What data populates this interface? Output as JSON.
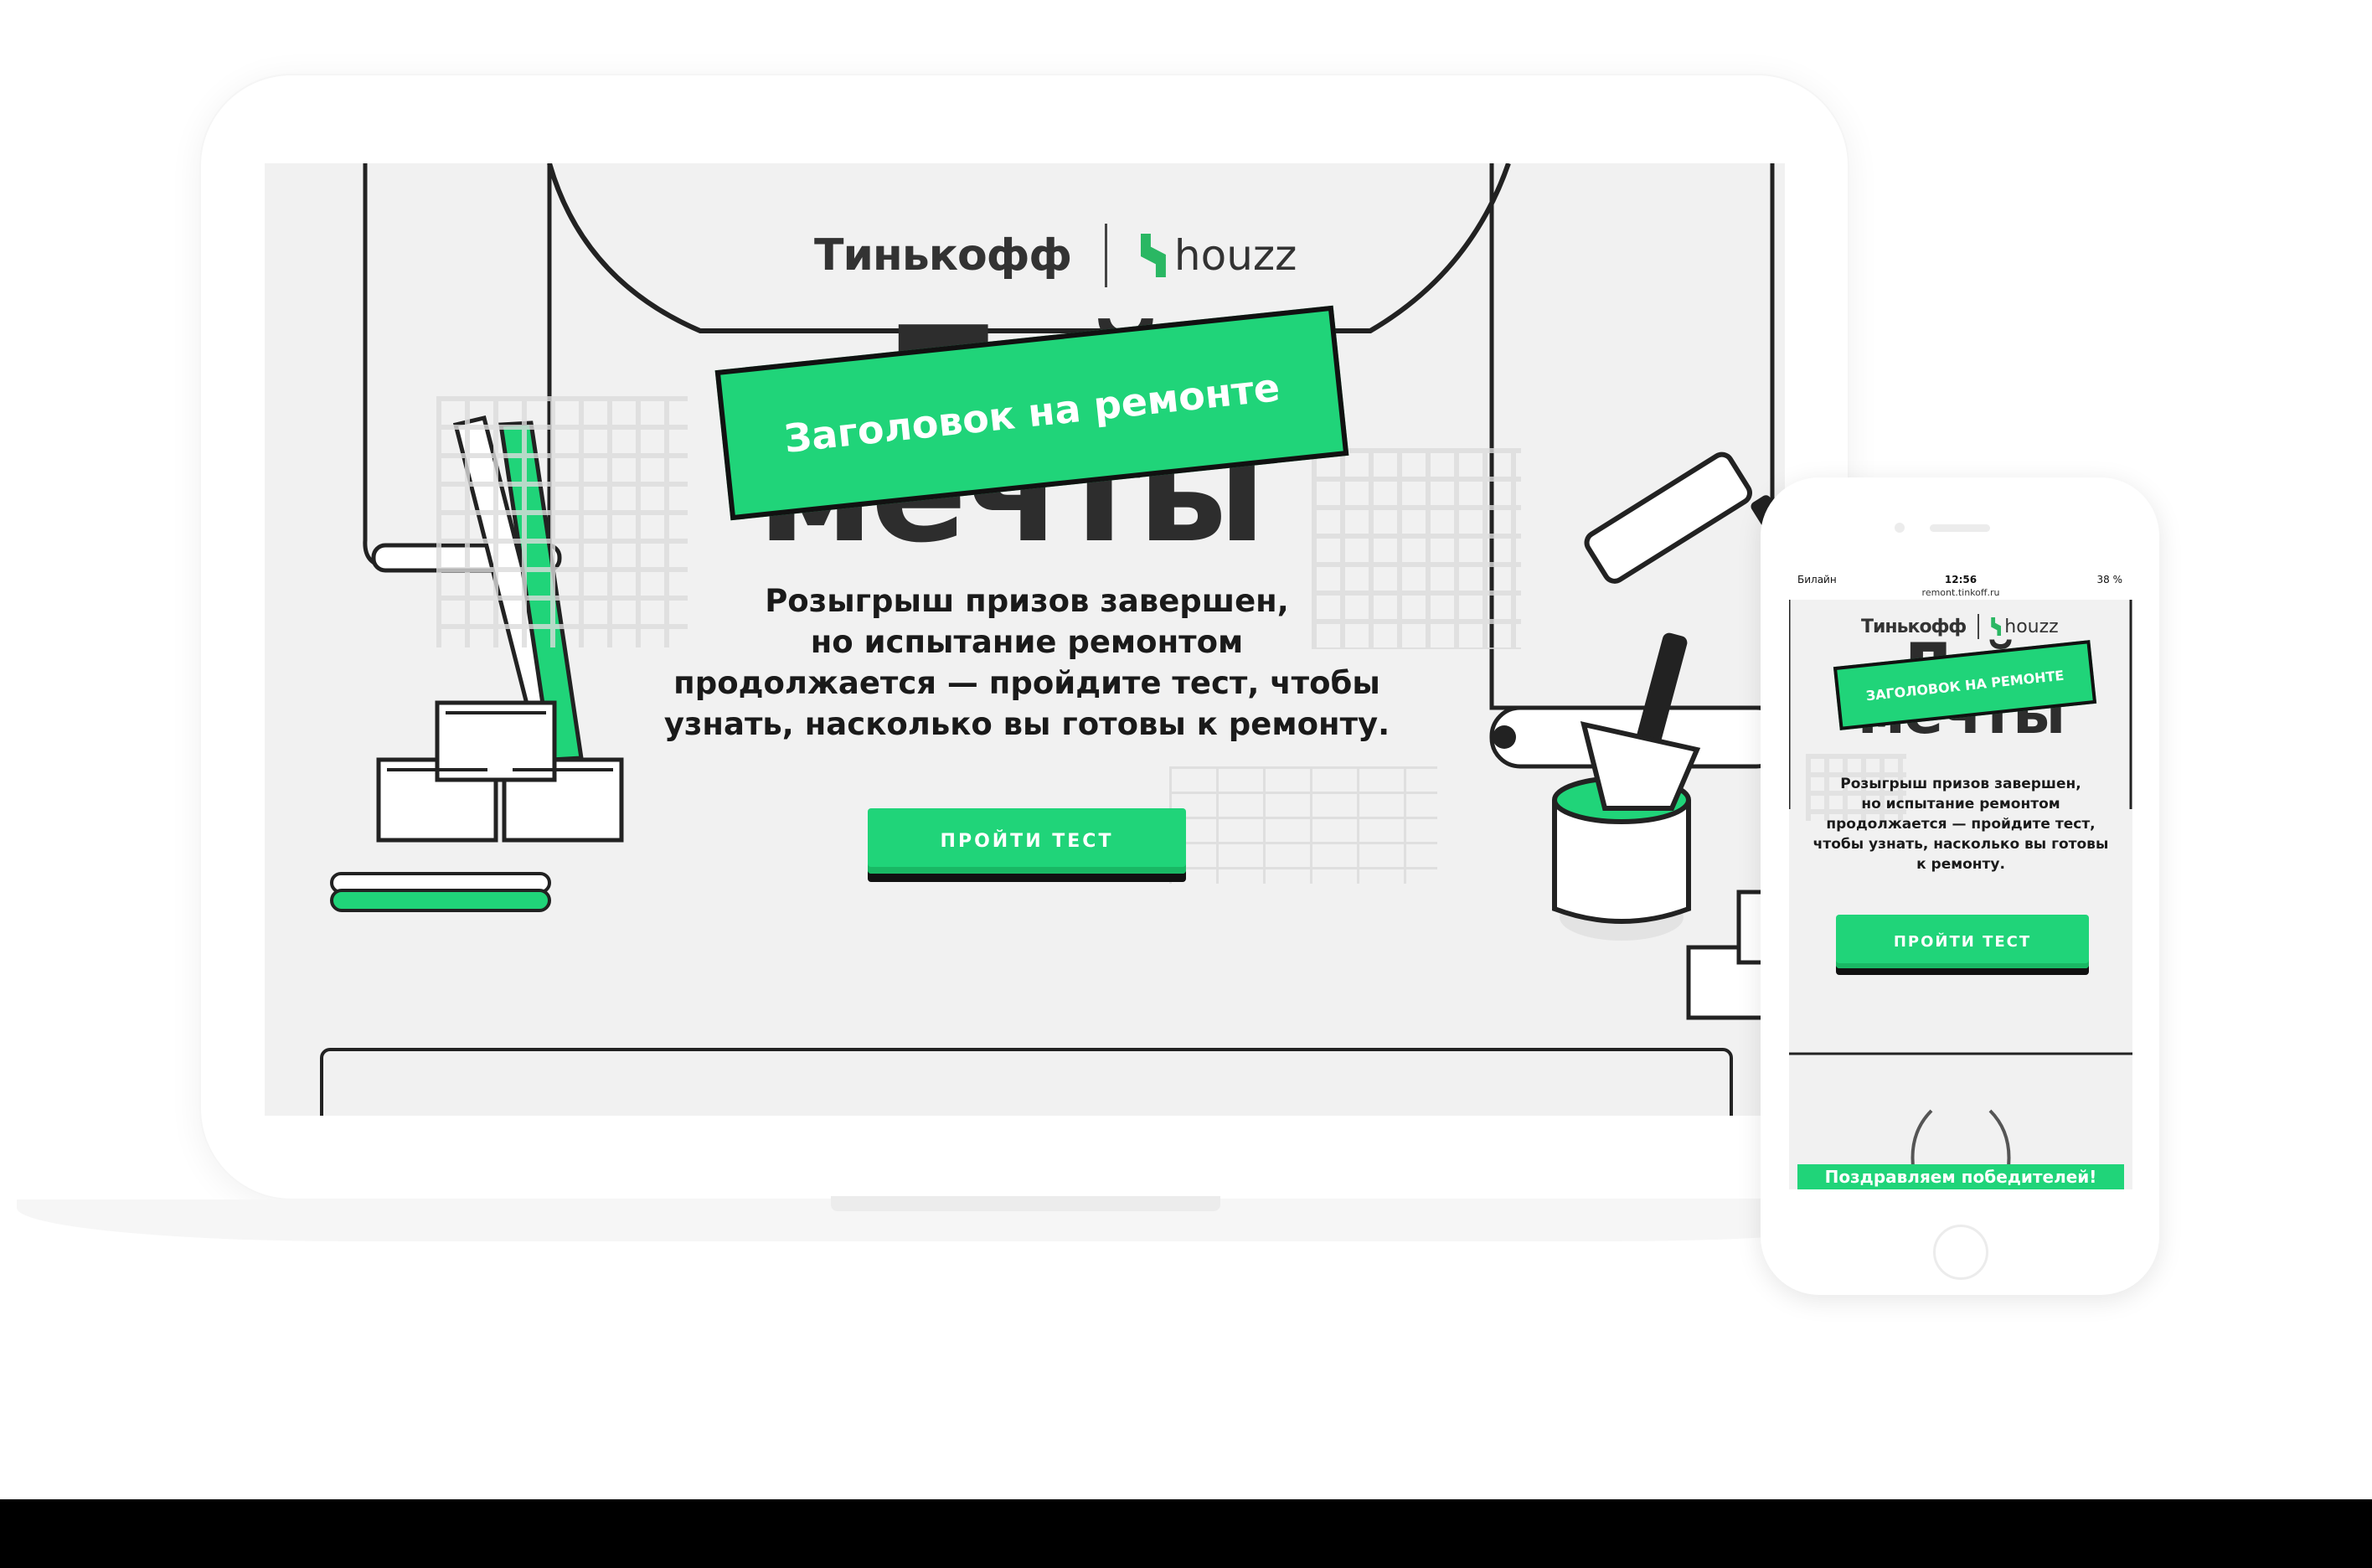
{
  "desktop": {
    "brand_left": "Тинькофф",
    "brand_right": "houzz",
    "headline_line1": "Д                          й",
    "headline_line2": "мечты",
    "tape_label": "Заголовок на ремонте",
    "intro_lines": [
      "Розыгрыш призов завершен,",
      "но испытание ремонтом",
      "продолжается — пройдите тест, чтобы",
      "узнать, насколько вы готовы к ремонту."
    ],
    "cta_label": "ПРОЙТИ ТЕСТ"
  },
  "mobile": {
    "status": {
      "carrier": "Билайн",
      "time": "12:56",
      "battery": "38 %",
      "url": "remont.tinkoff.ru"
    },
    "brand_left": "Тинькофф",
    "brand_right": "houzz",
    "headline_line1": "Д                    й",
    "headline_line2": "мечты",
    "tape_label": "ЗАГОЛОВОК НА РЕМОНТЕ",
    "intro_lines": [
      "Розыгрыш призов завершен,",
      "но испытание ремонтом",
      "продолжается — пройдите тест,",
      "чтобы узнать, насколько вы готовы",
      "к ремонту."
    ],
    "cta_label": "ПРОЙТИ ТЕСТ",
    "winners_label": "Поздравляем победителей!"
  },
  "colors": {
    "accent": "#20d479",
    "ink": "#111111",
    "screen_bg": "#f1f1f1"
  }
}
